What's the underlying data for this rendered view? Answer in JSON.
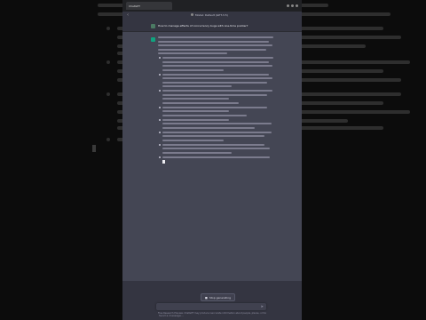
{
  "browser": {
    "tab_title": "ChatGPT"
  },
  "header": {
    "back_icon": "chevron-left-icon",
    "model_label": "Model: Default (GPT-3.5)"
  },
  "conversation": {
    "user_prompt": "How to manage effects of concurrency bugs with one-time pointer?",
    "assistant_paragraph_lines": 5,
    "bullet_items": [
      {
        "lines": 4
      },
      {
        "lines": 4
      },
      {
        "lines": 4
      },
      {
        "lines": 3
      },
      {
        "lines": 3
      },
      {
        "lines": 3
      },
      {
        "lines": 3
      },
      {
        "lines": 1
      }
    ]
  },
  "controls": {
    "regenerate_label": "Stop generating",
    "input_placeholder": "Send a message...",
    "send_icon": "paper-plane-icon"
  },
  "footer": {
    "text": "Free Research Preview. ChatGPT may produce inaccurate information about people, places, or facts."
  },
  "colors": {
    "accent": "#10a37f",
    "chat_bg": "#343541",
    "answer_bg": "#444654"
  }
}
